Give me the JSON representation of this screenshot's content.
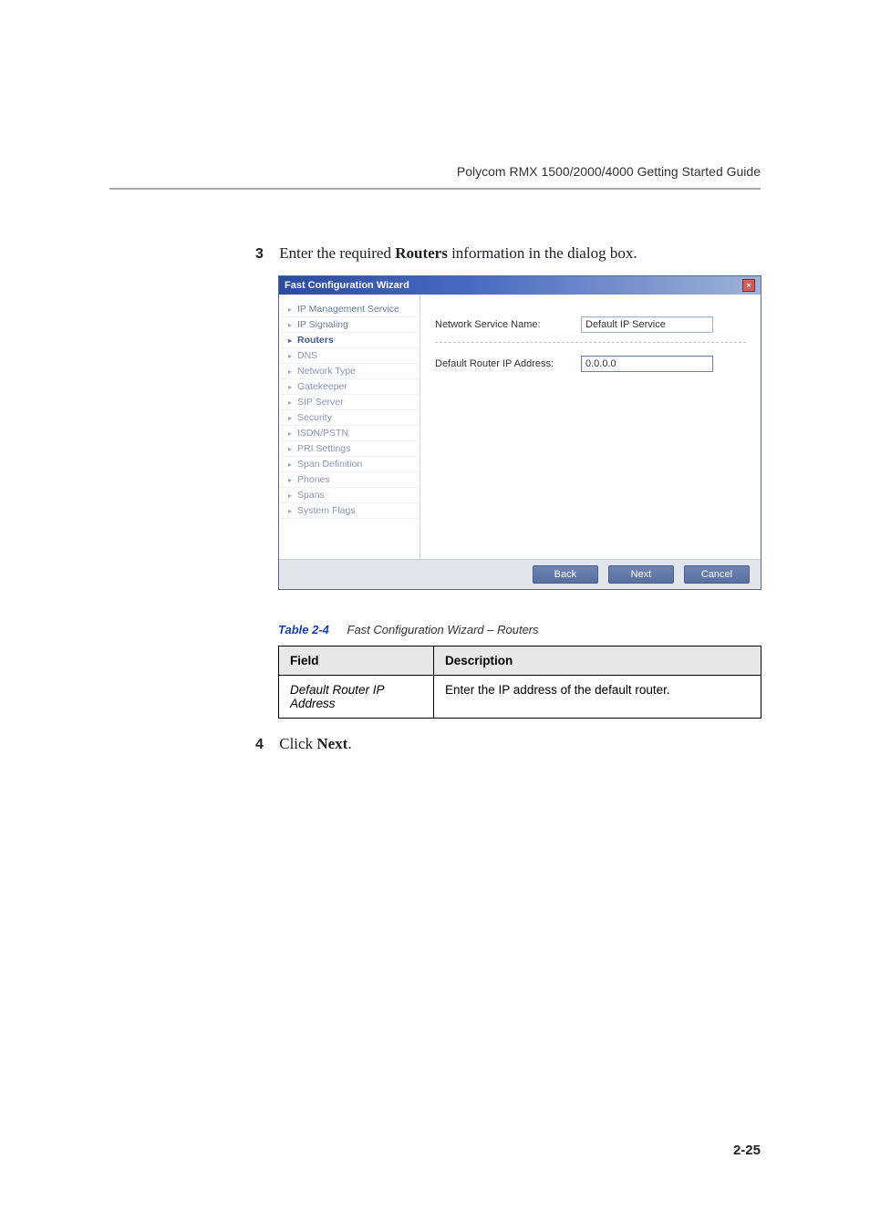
{
  "header": "Polycom RMX 1500/2000/4000 Getting Started Guide",
  "step3": {
    "number": "3",
    "text_before": "Enter the required ",
    "bold": "Routers",
    "text_after": " information in the dialog box."
  },
  "wizard": {
    "title": "Fast Configuration Wizard",
    "close_label": "×",
    "sidebar": [
      {
        "label": "IP Management Service"
      },
      {
        "label": "IP Signaling"
      },
      {
        "label": "Routers"
      },
      {
        "label": "DNS"
      },
      {
        "label": "Network Type"
      },
      {
        "label": "Gatekeeper"
      },
      {
        "label": "SIP Server"
      },
      {
        "label": "Security"
      },
      {
        "label": "ISDN/PSTN"
      },
      {
        "label": "PRI Settings"
      },
      {
        "label": "Span Definition"
      },
      {
        "label": "Phones"
      },
      {
        "label": "Spans"
      },
      {
        "label": "System Flags"
      }
    ],
    "service_name_label": "Network Service Name:",
    "service_name_value": "Default IP Service",
    "router_ip_label": "Default Router IP Address:",
    "router_ip_value": "0.0.0.0",
    "buttons": {
      "back": "Back",
      "next": "Next",
      "cancel": "Cancel"
    }
  },
  "table": {
    "caption_num": "Table 2-4",
    "caption_text": "Fast Configuration Wizard – Routers",
    "header_field": "Field",
    "header_desc": "Description",
    "rows": [
      {
        "field": "Default Router IP Address",
        "desc": "Enter the IP address of the default router."
      }
    ]
  },
  "step4": {
    "number": "4",
    "text_before": "Click ",
    "bold": "Next",
    "text_after": "."
  },
  "page_number": "2-25"
}
